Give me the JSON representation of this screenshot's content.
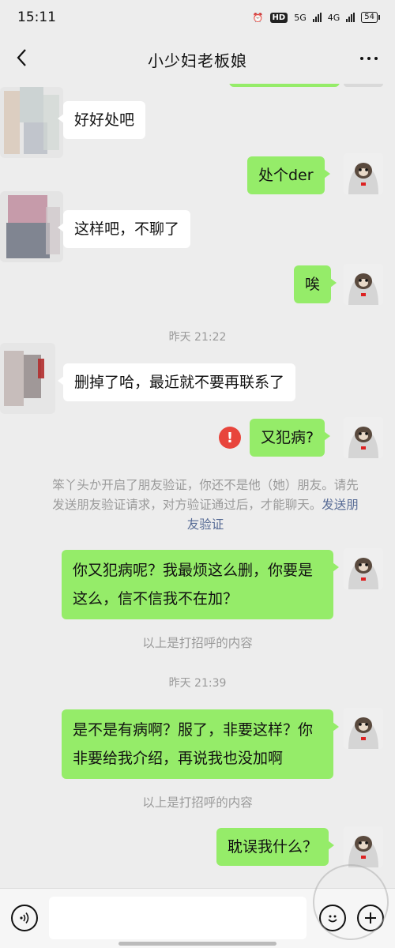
{
  "status_bar": {
    "time": "15:11",
    "hd_label": "HD",
    "net1": "5G",
    "net2": "4G",
    "battery": "54"
  },
  "header": {
    "title": "小少妇老板娘",
    "back_icon": "chevron-left-icon",
    "more_icon": "ellipsis-icon"
  },
  "messages": [
    {
      "side": "them",
      "text": "好好处吧"
    },
    {
      "side": "me",
      "text": "处个der"
    },
    {
      "side": "them",
      "text": "这样吧，不聊了"
    },
    {
      "side": "me",
      "text": "唉"
    },
    {
      "side": "them",
      "text": "删掉了哈，最近就不要再联系了"
    },
    {
      "side": "me",
      "text": "又犯病?",
      "failed": true
    },
    {
      "side": "me",
      "text": "你又犯病呢？我最烦这么删，你要是这么，信不信我不在加？"
    },
    {
      "side": "me",
      "text": "是不是有病啊？服了，非要这样？你非要给我介绍，再说我也没加啊"
    },
    {
      "side": "me",
      "text": "耽误我什么？"
    }
  ],
  "timestamps": [
    "昨天 21:22",
    "昨天 21:39"
  ],
  "system_notice": {
    "text": "笨丫头か开启了朋友验证，你还不是他（她）朋友。请先发送朋友验证请求，对方验证通过后，才能聊天。",
    "link": "发送朋友验证"
  },
  "greeting_notice": "以上是打招呼的内容",
  "error_mark": "!",
  "input_bar": {
    "placeholder": "",
    "voice_icon": "voice-icon",
    "emoji_icon": "emoji-icon",
    "plus_icon": "plus-icon"
  },
  "colors": {
    "background": "#ededed",
    "my_bubble": "#95ec69",
    "their_bubble": "#ffffff",
    "timestamp": "#9a9a9a",
    "link": "#576b95",
    "error": "#e8453c"
  }
}
